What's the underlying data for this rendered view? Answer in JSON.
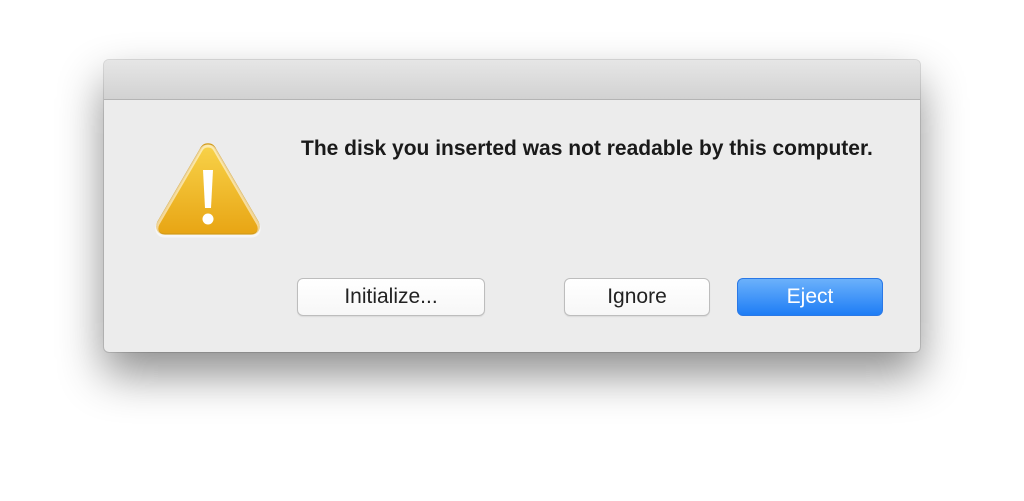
{
  "dialog": {
    "message": "The disk you inserted was not readable by this computer.",
    "icon": "warning-icon",
    "buttons": {
      "initialize": "Initialize...",
      "ignore": "Ignore",
      "eject": "Eject"
    },
    "colors": {
      "primary_button": "#1e7df5",
      "warning_icon": "#f0b91e",
      "dialog_background": "#ececec"
    }
  }
}
